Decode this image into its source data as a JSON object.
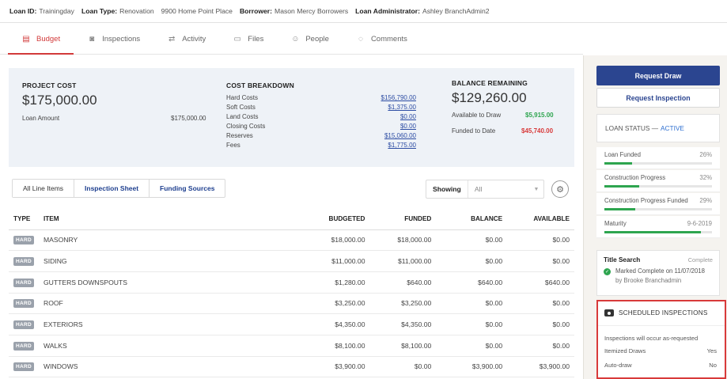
{
  "topbar": {
    "loan_id_label": "Loan ID:",
    "loan_id": "Trainingday",
    "loan_type_label": "Loan Type:",
    "loan_type": "Renovation",
    "address": "9900 Home Point Place",
    "borrower_label": "Borrower:",
    "borrower": "Mason Mercy Borrowers",
    "admin_label": "Loan Administrator:",
    "admin": "Ashley BranchAdmin2"
  },
  "tabs": [
    {
      "label": "Budget",
      "icon": "budget-icon"
    },
    {
      "label": "Inspections",
      "icon": "camera-icon"
    },
    {
      "label": "Activity",
      "icon": "arrows-icon"
    },
    {
      "label": "Files",
      "icon": "folder-icon"
    },
    {
      "label": "People",
      "icon": "people-icon"
    },
    {
      "label": "Comments",
      "icon": "comment-icon"
    }
  ],
  "summary": {
    "project_cost_label": "PROJECT COST",
    "project_cost": "$175,000.00",
    "loan_amount_label": "Loan Amount",
    "loan_amount": "$175,000.00",
    "cost_breakdown_label": "COST BREAKDOWN",
    "breakdown": [
      {
        "label": "Hard Costs",
        "value": "$156,790.00"
      },
      {
        "label": "Soft Costs",
        "value": "$1,375.00"
      },
      {
        "label": "Land Costs",
        "value": "$0.00"
      },
      {
        "label": "Closing Costs",
        "value": "$0.00"
      },
      {
        "label": "Reserves",
        "value": "$15,060.00"
      },
      {
        "label": "Fees",
        "value": "$1,775.00"
      }
    ],
    "balance_label": "BALANCE REMAINING",
    "balance": "$129,260.00",
    "available_label": "Available to Draw",
    "available": "$5,915.00",
    "funded_label": "Funded to Date",
    "funded": "$45,740.00",
    "available_color": "#2ea54f",
    "funded_color": "#d83a3a"
  },
  "subtabs": [
    "All Line Items",
    "Inspection Sheet",
    "Funding Sources"
  ],
  "showing": {
    "label": "Showing",
    "value": "All"
  },
  "table": {
    "headers": [
      "TYPE",
      "ITEM",
      "BUDGETED",
      "FUNDED",
      "BALANCE",
      "AVAILABLE"
    ],
    "rows": [
      {
        "type": "HARD",
        "item": "MASONRY",
        "budgeted": "$18,000.00",
        "funded": "$18,000.00",
        "balance": "$0.00",
        "available": "$0.00"
      },
      {
        "type": "HARD",
        "item": "SIDING",
        "budgeted": "$11,000.00",
        "funded": "$11,000.00",
        "balance": "$0.00",
        "available": "$0.00"
      },
      {
        "type": "HARD",
        "item": "GUTTERS DOWNSPOUTS",
        "budgeted": "$1,280.00",
        "funded": "$640.00",
        "balance": "$640.00",
        "available": "$640.00"
      },
      {
        "type": "HARD",
        "item": "ROOF",
        "budgeted": "$3,250.00",
        "funded": "$3,250.00",
        "balance": "$0.00",
        "available": "$0.00"
      },
      {
        "type": "HARD",
        "item": "EXTERIORS",
        "budgeted": "$4,350.00",
        "funded": "$4,350.00",
        "balance": "$0.00",
        "available": "$0.00"
      },
      {
        "type": "HARD",
        "item": "WALKS",
        "budgeted": "$8,100.00",
        "funded": "$8,100.00",
        "balance": "$0.00",
        "available": "$0.00"
      },
      {
        "type": "HARD",
        "item": "WINDOWS",
        "budgeted": "$3,900.00",
        "funded": "$0.00",
        "balance": "$3,900.00",
        "available": "$3,900.00"
      }
    ]
  },
  "sidebar": {
    "request_draw": "Request Draw",
    "request_inspection": "Request Inspection",
    "loan_status_label": "LOAN STATUS —",
    "loan_status": "ACTIVE",
    "progress": [
      {
        "label": "Loan Funded",
        "value": "26%",
        "fraction": 0.26
      },
      {
        "label": "Construction Progress",
        "value": "32%",
        "fraction": 0.32
      },
      {
        "label": "Construction Progress Funded",
        "value": "29%",
        "fraction": 0.29
      },
      {
        "label": "Maturity",
        "value": "9-6-2019",
        "fraction": 0.9
      }
    ],
    "title_search": {
      "title": "Title Search",
      "status": "Complete",
      "line1": "Marked Complete on 11/07/2018",
      "line2": "by Brooke Branchadmin"
    },
    "scheduled": {
      "title": "SCHEDULED INSPECTIONS",
      "note": "Inspections will occur as-requested",
      "itemized_label": "Itemized Draws",
      "itemized_value": "Yes",
      "autodraw_label": "Auto-draw",
      "autodraw_value": "No"
    }
  }
}
